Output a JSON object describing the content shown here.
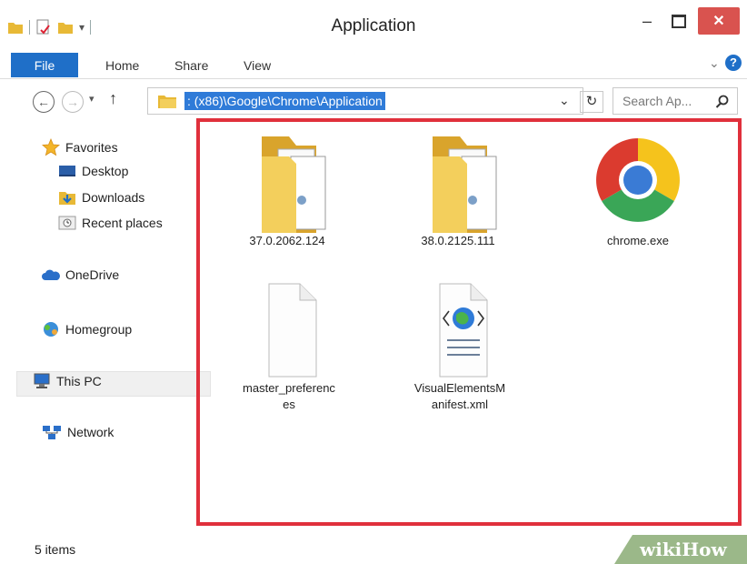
{
  "window": {
    "title": "Application",
    "minimize_glyph": "–",
    "close_glyph": "✕"
  },
  "ribbon": {
    "tabs": [
      {
        "label": "File"
      },
      {
        "label": "Home"
      },
      {
        "label": "Share"
      },
      {
        "label": "View"
      }
    ],
    "expand_glyph": "⌄",
    "help_glyph": "?"
  },
  "address": {
    "path": ": (x86)\\Google\\Chrome\\Application",
    "dropdown_glyph": "⌄",
    "refresh_glyph": "↻",
    "search_placeholder": "Search Ap...",
    "up_glyph": "↑"
  },
  "sidebar": {
    "favorites": "Favorites",
    "desktop": "Desktop",
    "downloads": "Downloads",
    "recent": "Recent places",
    "onedrive": "OneDrive",
    "homegroup": "Homegroup",
    "thispc": "This PC",
    "network": "Network"
  },
  "files": [
    {
      "name": "37.0.2062.124",
      "type": "folder"
    },
    {
      "name": "38.0.2125.111",
      "type": "folder"
    },
    {
      "name": "chrome.exe",
      "type": "chrome"
    },
    {
      "name": "master_preferenc\nes",
      "type": "blank"
    },
    {
      "name": "VisualElementsM\nanifest.xml",
      "type": "xml"
    }
  ],
  "status": {
    "items": "5 items"
  },
  "watermark": {
    "text": "wikiHow"
  },
  "colors": {
    "accent": "#1f6fc8",
    "highlight": "#e0303c",
    "close": "#d9534f"
  }
}
